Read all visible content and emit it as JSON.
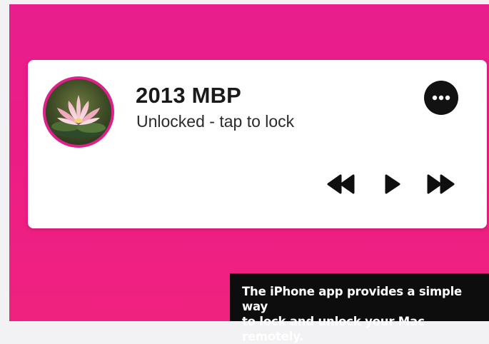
{
  "device": {
    "name": "2013 MBP",
    "status": "Unlocked - tap to lock",
    "avatar_icon": "water-lily-photo"
  },
  "controls": {
    "more_icon": "ellipsis-icon",
    "rewind_icon": "rewind-icon",
    "play_icon": "play-icon",
    "fast_forward_icon": "fast-forward-icon"
  },
  "caption": {
    "text": "The iPhone app provides a simple way\nto lock and unlock your Mac remotely."
  },
  "colors": {
    "background_pink": "#ec1c86",
    "avatar_ring": "#e0208a",
    "card": "#ffffff",
    "caption_bg": "#0d0d0d"
  }
}
